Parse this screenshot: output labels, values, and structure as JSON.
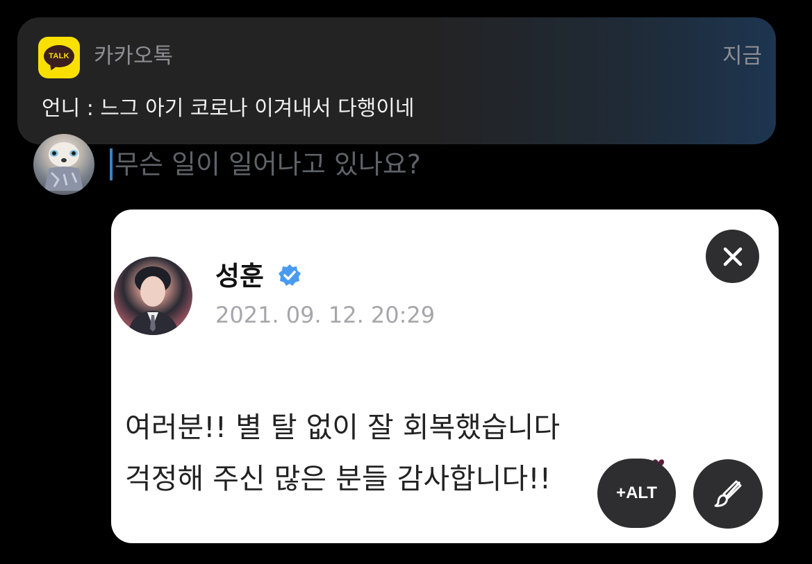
{
  "notification": {
    "app_icon": "kakaotalk-talk-icon",
    "app_icon_text": "TALK",
    "app_name": "카카오톡",
    "time": "지금",
    "message": "언니 : 느그 아기 코로나 이겨내서 다행이네"
  },
  "compose": {
    "placeholder": "무슨 일이 일어나고 있나요?"
  },
  "attachment": {
    "author_name": "성훈",
    "verified_icon": "verified-badge-icon",
    "date": "2021. 09. 12. 20:29",
    "lines": [
      "여러분!! 별 탈 없이 잘 회복했습니다",
      "걱정해 주신 많은 분들 감사합니다!!"
    ],
    "emoji_icon": "hearts-icon",
    "colors": {
      "verified": "#4a9bf0",
      "hearts": "#5c1a3c"
    }
  },
  "controls": {
    "close_icon": "close-icon",
    "alt_label": "+ALT",
    "edit_icon": "paintbrush-icon"
  },
  "colors": {
    "kakao_yellow": "#f9e000",
    "caret": "#3a82c4",
    "button_bg": "#2e2e30"
  }
}
